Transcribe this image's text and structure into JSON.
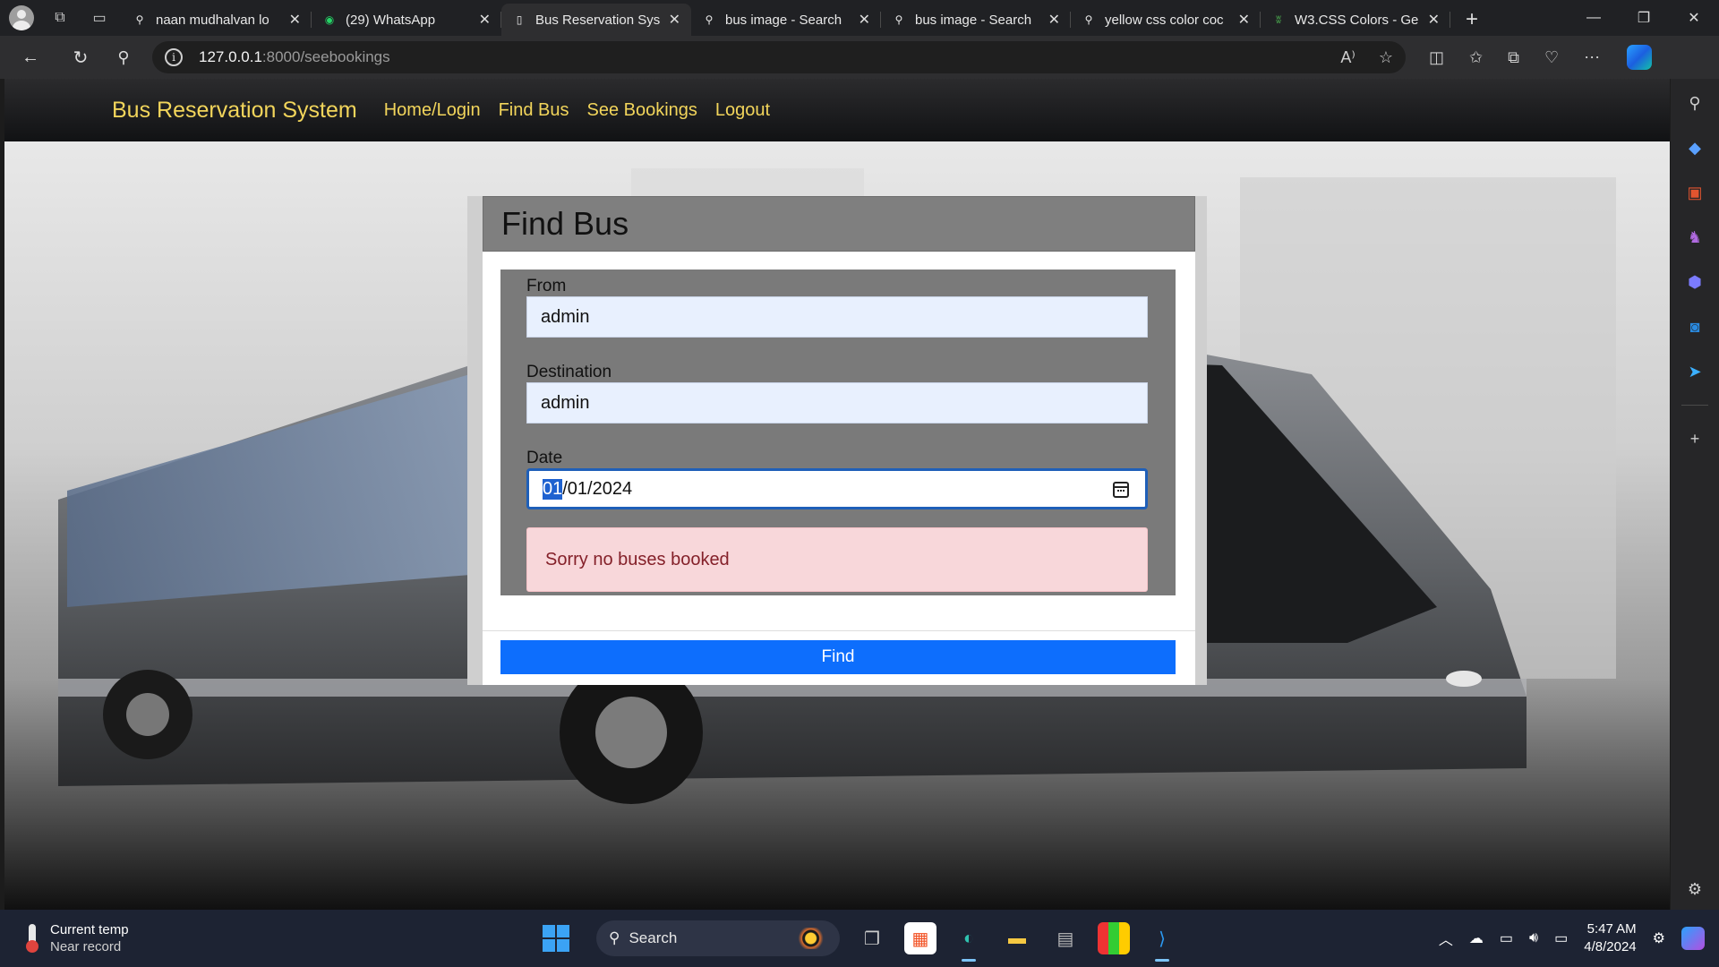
{
  "browser": {
    "tabs": [
      {
        "title": "naan mudhalvan lo",
        "icon": "search-icon"
      },
      {
        "title": "(29) WhatsApp",
        "icon": "whatsapp-icon"
      },
      {
        "title": "Bus Reservation Sys",
        "icon": "page-icon",
        "active": true
      },
      {
        "title": "bus image - Search",
        "icon": "search-icon"
      },
      {
        "title": "bus image - Search",
        "icon": "search-icon"
      },
      {
        "title": "yellow css color coc",
        "icon": "search-icon"
      },
      {
        "title": "W3.CSS Colors - Ge",
        "icon": "w3-icon"
      }
    ],
    "url_host": "127.0.0.1",
    "url_path": ":8000/seebookings"
  },
  "navbar": {
    "brand": "Bus Reservation System",
    "links": [
      "Home/Login",
      "Find Bus",
      "See Bookings",
      "Logout"
    ],
    "link_color": "#f2d55b"
  },
  "modal": {
    "title": "Find Bus",
    "from_label": "From",
    "from_value": "admin",
    "destination_label": "Destination",
    "destination_value": "admin",
    "date_label": "Date",
    "date_selected": "01",
    "date_rest": "/01/2024",
    "alert": "Sorry no buses booked",
    "button": "Find",
    "button_color": "#0d6efd"
  },
  "taskbar": {
    "weather_title": "Current temp",
    "weather_sub": "Near record",
    "search": "Search",
    "time": "5:47 AM",
    "date": "4/8/2024"
  }
}
